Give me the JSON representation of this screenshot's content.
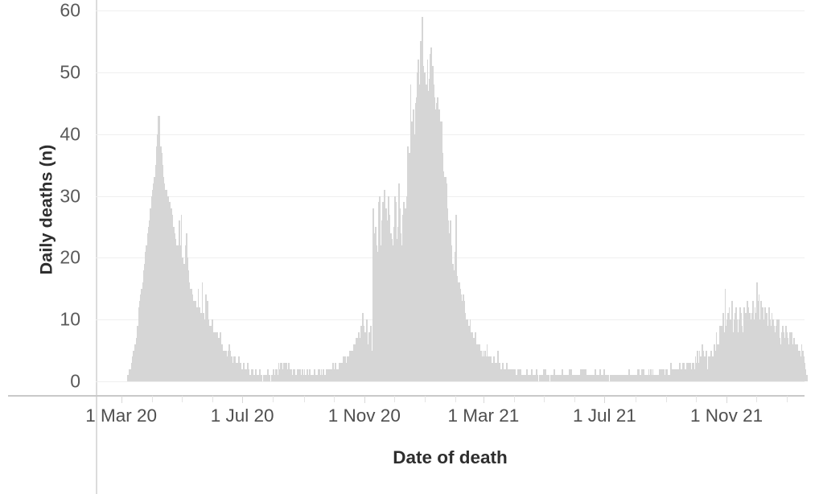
{
  "chart_data": {
    "type": "bar",
    "title": "",
    "subtitle": "",
    "xlabel": "Date of death",
    "ylabel": "Daily deaths (n)",
    "ylim": [
      0,
      60
    ],
    "yticks": [
      0,
      10,
      20,
      30,
      40,
      50,
      60
    ],
    "ytick_labels": [
      "0",
      "10",
      "20",
      "30",
      "40",
      "50",
      "60"
    ],
    "xlim": [
      "2020-02-25",
      "2021-12-15"
    ],
    "xtick_labels": [
      "1 Mar 20",
      "1 Jul 20",
      "1 Nov 20",
      "1 Mar 21",
      "1 Jul 21",
      "1 Nov 21"
    ],
    "xtick_dates": [
      "2020-03-01",
      "2020-07-01",
      "2020-11-01",
      "2021-03-01",
      "2021-07-01",
      "2021-11-01"
    ],
    "grid": "horizontal",
    "legend": "none",
    "bar_color": "#d6d6d6",
    "gridline_color": "#efefef",
    "axis_color": "#c9c9c9",
    "text_color": "#4f4f4f",
    "title_color": "#2e2e2e",
    "series_name": "Daily deaths",
    "x_start_date": "2020-03-07",
    "n_points": 645,
    "values": [
      1,
      1,
      2,
      2,
      3,
      4,
      5,
      6,
      6,
      7,
      9,
      12,
      13,
      14,
      15,
      16,
      18,
      19,
      21,
      22,
      24,
      25,
      26,
      28,
      30,
      31,
      32,
      33,
      35,
      38,
      40,
      43,
      43,
      38,
      37,
      35,
      33,
      32,
      31,
      31,
      30,
      30,
      29,
      28,
      28,
      27,
      25,
      24,
      23,
      22,
      22,
      21,
      26,
      22,
      27,
      20,
      18,
      19,
      22,
      24,
      20,
      18,
      16,
      15,
      15,
      14,
      13,
      13,
      13,
      12,
      12,
      15,
      12,
      11,
      11,
      16,
      11,
      10,
      10,
      14,
      13,
      10,
      9,
      9,
      9,
      10,
      8,
      8,
      8,
      8,
      8,
      7,
      7,
      8,
      6,
      6,
      5,
      5,
      5,
      5,
      4,
      5,
      6,
      5,
      4,
      4,
      3,
      4,
      4,
      3,
      3,
      3,
      4,
      3,
      3,
      2,
      2,
      3,
      2,
      2,
      2,
      3,
      2,
      1,
      1,
      2,
      2,
      1,
      1,
      2,
      1,
      1,
      1,
      2,
      1,
      1,
      0,
      1,
      1,
      1,
      1,
      2,
      1,
      1,
      0,
      1,
      1,
      2,
      1,
      2,
      2,
      1,
      3,
      2,
      3,
      3,
      2,
      3,
      3,
      2,
      3,
      2,
      3,
      2,
      2,
      2,
      1,
      2,
      2,
      1,
      1,
      2,
      1,
      2,
      2,
      1,
      2,
      1,
      2,
      1,
      1,
      2,
      1,
      2,
      1,
      1,
      1,
      1,
      2,
      1,
      1,
      1,
      2,
      2,
      1,
      2,
      1,
      2,
      1,
      1,
      2,
      2,
      1,
      2,
      2,
      2,
      2,
      3,
      2,
      3,
      2,
      2,
      2,
      3,
      2,
      3,
      3,
      4,
      3,
      4,
      3,
      4,
      4,
      4,
      5,
      5,
      5,
      5,
      6,
      6,
      7,
      6,
      7,
      8,
      7,
      9,
      8,
      11,
      9,
      8,
      7,
      10,
      6,
      8,
      4,
      9,
      5,
      28,
      8,
      24,
      25,
      22,
      21,
      29,
      30,
      22,
      26,
      29,
      22,
      31,
      28,
      26,
      26,
      30,
      27,
      24,
      23,
      22,
      25,
      30,
      29,
      23,
      25,
      32,
      28,
      24,
      22,
      27,
      29,
      25,
      28,
      30,
      38,
      34,
      37,
      48,
      42,
      37,
      44,
      40,
      45,
      46,
      50,
      52,
      48,
      55,
      47,
      59,
      51,
      50,
      46,
      48,
      52,
      47,
      49,
      53,
      54,
      51,
      48,
      46,
      44,
      45,
      46,
      43,
      44,
      42,
      42,
      37,
      34,
      33,
      33,
      32,
      28,
      26,
      24,
      26,
      22,
      19,
      19,
      18,
      21,
      27,
      17,
      16,
      16,
      15,
      14,
      13,
      14,
      13,
      11,
      10,
      10,
      9,
      9,
      10,
      8,
      8,
      7,
      7,
      8,
      6,
      6,
      6,
      6,
      5,
      5,
      4,
      5,
      4,
      5,
      4,
      6,
      4,
      4,
      3,
      4,
      3,
      3,
      4,
      3,
      3,
      3,
      5,
      3,
      3,
      2,
      2,
      3,
      2,
      2,
      2,
      3,
      2,
      2,
      2,
      2,
      2,
      2,
      2,
      2,
      1,
      1,
      2,
      1,
      2,
      2,
      1,
      1,
      1,
      1,
      1,
      2,
      1,
      1,
      1,
      1,
      2,
      1,
      1,
      1,
      1,
      2,
      1,
      0,
      1,
      1,
      1,
      1,
      2,
      1,
      2,
      1,
      1,
      1,
      0,
      1,
      1,
      1,
      1,
      2,
      1,
      1,
      0,
      1,
      1,
      1,
      1,
      2,
      1,
      1,
      1,
      1,
      1,
      1,
      2,
      1,
      2,
      1,
      1,
      1,
      1,
      1,
      1,
      1,
      1,
      2,
      2,
      1,
      2,
      2,
      2,
      1,
      1,
      1,
      1,
      1,
      1,
      1,
      1,
      1,
      2,
      1,
      1,
      1,
      1,
      2,
      1,
      1,
      1,
      2,
      1,
      1,
      1,
      1,
      0,
      1,
      1,
      1,
      0,
      1,
      1,
      0,
      1,
      1,
      1,
      1,
      1,
      1,
      1,
      1,
      1,
      1,
      1,
      1,
      2,
      1,
      1,
      1,
      1,
      1,
      1,
      1,
      1,
      2,
      2,
      1,
      1,
      2,
      1,
      2,
      1,
      1,
      1,
      1,
      2,
      1,
      2,
      1,
      2,
      1,
      1,
      1,
      1,
      1,
      1,
      2,
      2,
      2,
      2,
      2,
      1,
      2,
      2,
      1,
      1,
      1,
      3,
      1,
      2,
      2,
      2,
      2,
      2,
      2,
      2,
      3,
      2,
      2,
      3,
      3,
      2,
      2,
      3,
      3,
      3,
      2,
      3,
      2,
      3,
      3,
      2,
      4,
      3,
      5,
      3,
      5,
      4,
      3,
      6,
      5,
      4,
      3,
      5,
      2,
      4,
      4,
      4,
      5,
      4,
      4,
      6,
      5,
      8,
      6,
      5,
      6,
      9,
      9,
      8,
      11,
      8,
      15,
      9,
      10,
      11,
      12,
      10,
      9,
      13,
      8,
      10,
      11,
      12,
      10,
      8,
      10,
      12,
      11,
      9,
      8,
      12,
      11,
      11,
      13,
      12,
      9,
      11,
      10,
      11,
      13,
      10,
      12,
      11,
      16,
      13,
      14,
      10,
      13,
      12,
      12,
      10,
      12,
      11,
      11,
      9,
      12,
      10,
      9,
      11,
      10,
      9,
      8,
      9,
      10,
      9,
      10,
      7,
      6,
      8,
      9,
      8,
      7,
      9,
      8,
      7,
      6,
      8,
      7,
      8,
      6,
      7,
      5,
      6,
      6,
      6,
      5,
      5,
      4,
      6,
      5,
      4,
      3,
      2,
      1
    ]
  }
}
